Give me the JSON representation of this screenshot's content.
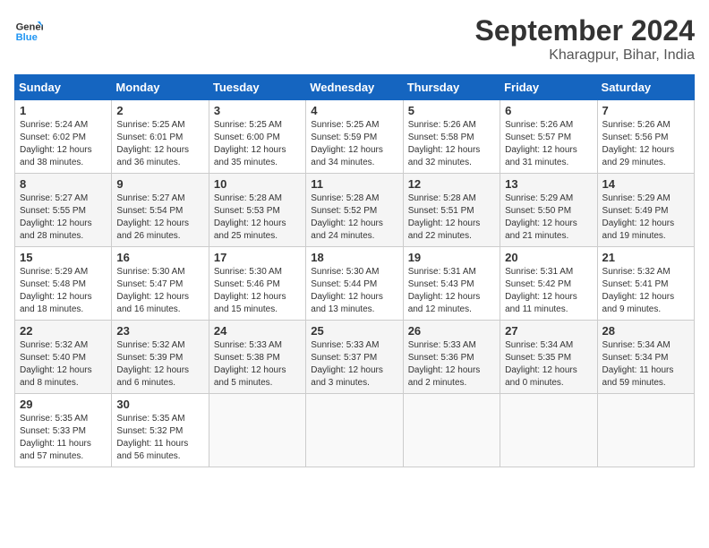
{
  "header": {
    "logo_line1": "General",
    "logo_line2": "Blue",
    "month": "September 2024",
    "location": "Kharagpur, Bihar, India"
  },
  "weekdays": [
    "Sunday",
    "Monday",
    "Tuesday",
    "Wednesday",
    "Thursday",
    "Friday",
    "Saturday"
  ],
  "weeks": [
    [
      {
        "day": "1",
        "info": "Sunrise: 5:24 AM\nSunset: 6:02 PM\nDaylight: 12 hours\nand 38 minutes."
      },
      {
        "day": "2",
        "info": "Sunrise: 5:25 AM\nSunset: 6:01 PM\nDaylight: 12 hours\nand 36 minutes."
      },
      {
        "day": "3",
        "info": "Sunrise: 5:25 AM\nSunset: 6:00 PM\nDaylight: 12 hours\nand 35 minutes."
      },
      {
        "day": "4",
        "info": "Sunrise: 5:25 AM\nSunset: 5:59 PM\nDaylight: 12 hours\nand 34 minutes."
      },
      {
        "day": "5",
        "info": "Sunrise: 5:26 AM\nSunset: 5:58 PM\nDaylight: 12 hours\nand 32 minutes."
      },
      {
        "day": "6",
        "info": "Sunrise: 5:26 AM\nSunset: 5:57 PM\nDaylight: 12 hours\nand 31 minutes."
      },
      {
        "day": "7",
        "info": "Sunrise: 5:26 AM\nSunset: 5:56 PM\nDaylight: 12 hours\nand 29 minutes."
      }
    ],
    [
      {
        "day": "8",
        "info": "Sunrise: 5:27 AM\nSunset: 5:55 PM\nDaylight: 12 hours\nand 28 minutes."
      },
      {
        "day": "9",
        "info": "Sunrise: 5:27 AM\nSunset: 5:54 PM\nDaylight: 12 hours\nand 26 minutes."
      },
      {
        "day": "10",
        "info": "Sunrise: 5:28 AM\nSunset: 5:53 PM\nDaylight: 12 hours\nand 25 minutes."
      },
      {
        "day": "11",
        "info": "Sunrise: 5:28 AM\nSunset: 5:52 PM\nDaylight: 12 hours\nand 24 minutes."
      },
      {
        "day": "12",
        "info": "Sunrise: 5:28 AM\nSunset: 5:51 PM\nDaylight: 12 hours\nand 22 minutes."
      },
      {
        "day": "13",
        "info": "Sunrise: 5:29 AM\nSunset: 5:50 PM\nDaylight: 12 hours\nand 21 minutes."
      },
      {
        "day": "14",
        "info": "Sunrise: 5:29 AM\nSunset: 5:49 PM\nDaylight: 12 hours\nand 19 minutes."
      }
    ],
    [
      {
        "day": "15",
        "info": "Sunrise: 5:29 AM\nSunset: 5:48 PM\nDaylight: 12 hours\nand 18 minutes."
      },
      {
        "day": "16",
        "info": "Sunrise: 5:30 AM\nSunset: 5:47 PM\nDaylight: 12 hours\nand 16 minutes."
      },
      {
        "day": "17",
        "info": "Sunrise: 5:30 AM\nSunset: 5:46 PM\nDaylight: 12 hours\nand 15 minutes."
      },
      {
        "day": "18",
        "info": "Sunrise: 5:30 AM\nSunset: 5:44 PM\nDaylight: 12 hours\nand 13 minutes."
      },
      {
        "day": "19",
        "info": "Sunrise: 5:31 AM\nSunset: 5:43 PM\nDaylight: 12 hours\nand 12 minutes."
      },
      {
        "day": "20",
        "info": "Sunrise: 5:31 AM\nSunset: 5:42 PM\nDaylight: 12 hours\nand 11 minutes."
      },
      {
        "day": "21",
        "info": "Sunrise: 5:32 AM\nSunset: 5:41 PM\nDaylight: 12 hours\nand 9 minutes."
      }
    ],
    [
      {
        "day": "22",
        "info": "Sunrise: 5:32 AM\nSunset: 5:40 PM\nDaylight: 12 hours\nand 8 minutes."
      },
      {
        "day": "23",
        "info": "Sunrise: 5:32 AM\nSunset: 5:39 PM\nDaylight: 12 hours\nand 6 minutes."
      },
      {
        "day": "24",
        "info": "Sunrise: 5:33 AM\nSunset: 5:38 PM\nDaylight: 12 hours\nand 5 minutes."
      },
      {
        "day": "25",
        "info": "Sunrise: 5:33 AM\nSunset: 5:37 PM\nDaylight: 12 hours\nand 3 minutes."
      },
      {
        "day": "26",
        "info": "Sunrise: 5:33 AM\nSunset: 5:36 PM\nDaylight: 12 hours\nand 2 minutes."
      },
      {
        "day": "27",
        "info": "Sunrise: 5:34 AM\nSunset: 5:35 PM\nDaylight: 12 hours\nand 0 minutes."
      },
      {
        "day": "28",
        "info": "Sunrise: 5:34 AM\nSunset: 5:34 PM\nDaylight: 11 hours\nand 59 minutes."
      }
    ],
    [
      {
        "day": "29",
        "info": "Sunrise: 5:35 AM\nSunset: 5:33 PM\nDaylight: 11 hours\nand 57 minutes."
      },
      {
        "day": "30",
        "info": "Sunrise: 5:35 AM\nSunset: 5:32 PM\nDaylight: 11 hours\nand 56 minutes."
      },
      {
        "day": "",
        "info": ""
      },
      {
        "day": "",
        "info": ""
      },
      {
        "day": "",
        "info": ""
      },
      {
        "day": "",
        "info": ""
      },
      {
        "day": "",
        "info": ""
      }
    ]
  ]
}
